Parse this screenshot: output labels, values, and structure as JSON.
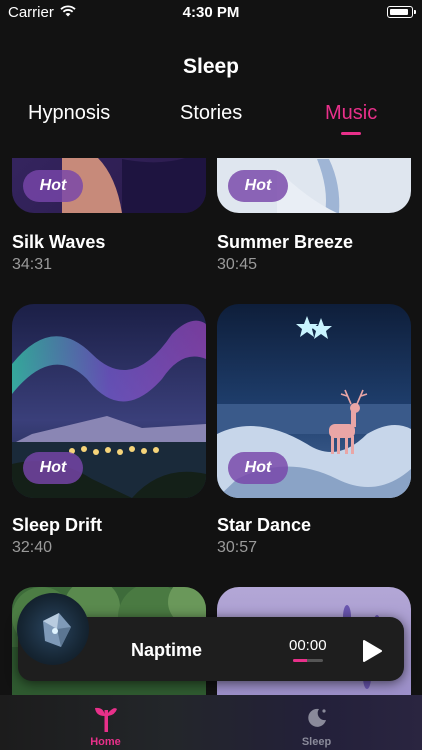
{
  "status": {
    "carrier": "Carrier",
    "time": "4:30 PM"
  },
  "header": {
    "title": "Sleep"
  },
  "tabs": [
    {
      "label": "Hypnosis",
      "active": false
    },
    {
      "label": "Stories",
      "active": false
    },
    {
      "label": "Music",
      "active": true
    }
  ],
  "items": [
    {
      "title": "Silk Waves",
      "duration": "34:31",
      "badge": "Hot"
    },
    {
      "title": "Summer Breeze",
      "duration": "30:45",
      "badge": "Hot"
    },
    {
      "title": "Sleep Drift",
      "duration": "32:40",
      "badge": "Hot"
    },
    {
      "title": "Star Dance",
      "duration": "30:57",
      "badge": "Hot"
    },
    {
      "title": "",
      "duration": ""
    },
    {
      "title": "",
      "duration": ""
    }
  ],
  "player": {
    "title": "Naptime",
    "time": "00:00",
    "progress": 0.45
  },
  "tabbar": [
    {
      "label": "Home",
      "icon": "sprout-icon",
      "active": true
    },
    {
      "label": "Sleep",
      "icon": "moon-icon",
      "active": false
    }
  ],
  "colors": {
    "accent": "#e8308a",
    "badge": "#7846aa",
    "background": "#121212"
  }
}
